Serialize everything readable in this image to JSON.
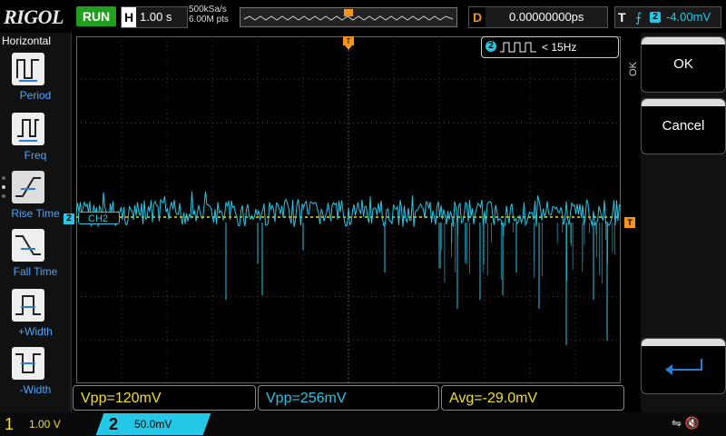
{
  "brand": "RIGOL",
  "run_state": "RUN",
  "horizontal": {
    "key": "H",
    "timebase": "1.00 s",
    "sample_rate": "500kSa/s",
    "memory_depth": "6.00M pts"
  },
  "delay": {
    "key": "D",
    "value": "0.00000000ps"
  },
  "trigger": {
    "key": "T",
    "source": "2",
    "level": "-4.00mV",
    "marker": "T"
  },
  "left_menu": {
    "title": "Horizontal",
    "items": [
      "Period",
      "Freq",
      "Rise Time",
      "Fall Time",
      "+Width",
      "-Width"
    ]
  },
  "frequency_counter": {
    "channel": "2",
    "value": "< 15Hz"
  },
  "channel_marker": {
    "number": "2",
    "label": "CH2"
  },
  "right_menu": {
    "side_label": "OK",
    "ok": "OK",
    "cancel": "Cancel"
  },
  "measurements": [
    "Vpp=120mV",
    "Vpp=256mV",
    "Avg=-29.0mV"
  ],
  "channels": [
    {
      "number": "1",
      "scale": "1.00 V"
    },
    {
      "number": "2",
      "scale": "50.0mV"
    }
  ],
  "colors": {
    "ch1": "#f0e020",
    "ch2": "#22c8e6",
    "trigger": "#f7941d",
    "run": "#1ea21e"
  }
}
